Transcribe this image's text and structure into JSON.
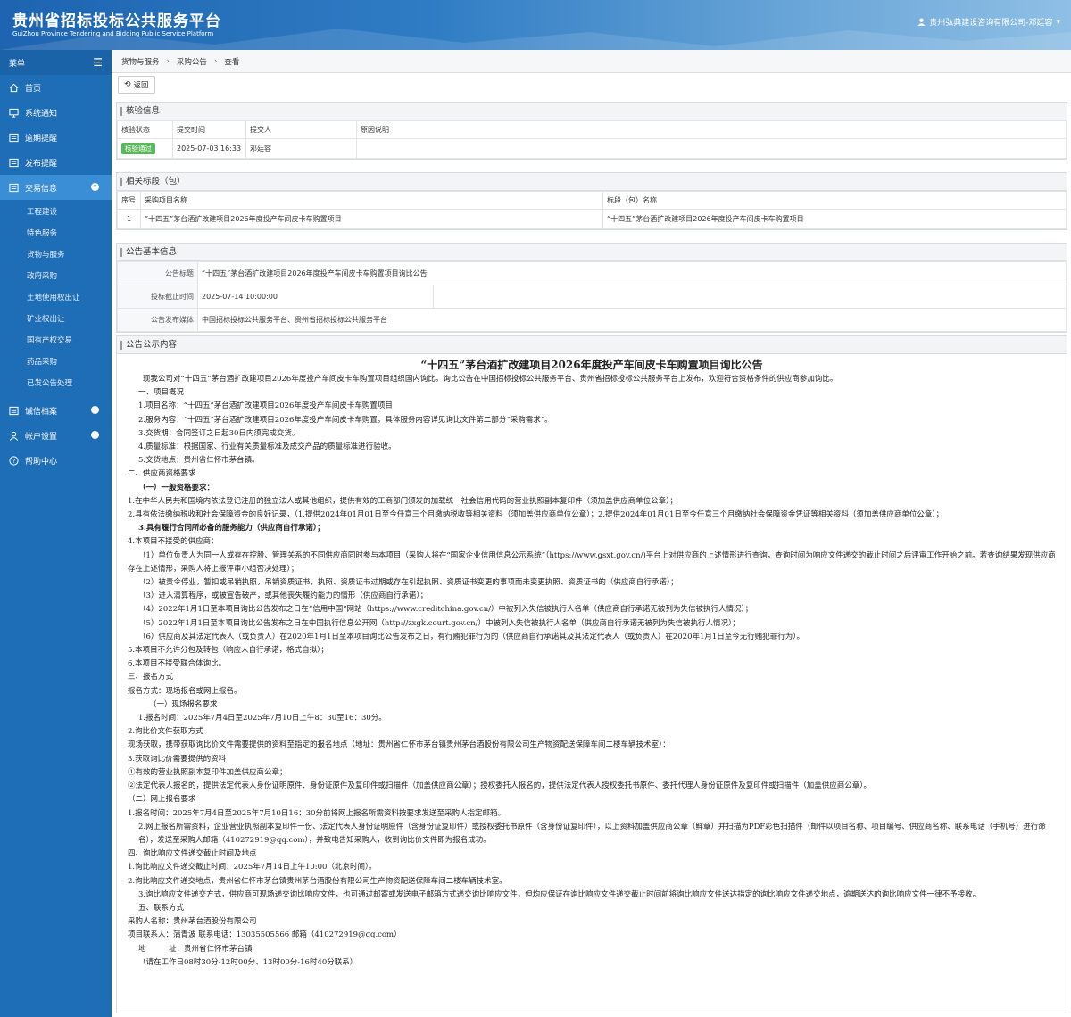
{
  "header": {
    "title": "贵州省招标投标公共服务平台",
    "subtitle": "GuiZhou Province Tendering and Bidding Public Service Platform",
    "user": "贵州弘典建设咨询有限公司-邓廷容"
  },
  "sidebar": {
    "menu_label": "菜单",
    "items": [
      {
        "label": "首页"
      },
      {
        "label": "系统通知"
      },
      {
        "label": "逾期提醒"
      },
      {
        "label": "发布提醒"
      },
      {
        "label": "交易信息"
      }
    ],
    "sub_items": [
      "工程建设",
      "特色服务",
      "货物与服务",
      "政府采购",
      "土地使用权出让",
      "矿业权出让",
      "国有产权交易",
      "药品采购",
      "已发公告处理"
    ],
    "bottom_items": [
      {
        "label": "诚信档案"
      },
      {
        "label": "帐户设置"
      },
      {
        "label": "帮助中心"
      }
    ]
  },
  "breadcrumb": [
    "货物与服务",
    "采购公告",
    "查看"
  ],
  "back_label": "返回",
  "verify": {
    "title": "核验信息",
    "headers": [
      "核验状态",
      "提交时间",
      "提交人",
      "原因说明"
    ],
    "row": {
      "status": "核验通过",
      "time": "2025-07-03 16:33",
      "person": "邓廷容",
      "reason": ""
    }
  },
  "sections": {
    "title": "相关标段（包）",
    "headers": [
      "序号",
      "采购项目名称",
      "标段（包）名称"
    ],
    "row": {
      "no": "1",
      "project": "“十四五”茅台酒扩改建项目2026年度投产车间皮卡车购置项目",
      "section": "“十四五”茅台酒扩改建项目2026年度投产车间皮卡车购置项目"
    }
  },
  "basic": {
    "title": "公告基本信息",
    "rows": [
      {
        "k": "公告标题",
        "v": "“十四五”茅台酒扩改建项目2026年度投产车间皮卡车购置项目询比公告"
      },
      {
        "k": "投标截止时间",
        "v": "2025-07-14 10:00:00"
      },
      {
        "k": "公告发布媒体",
        "v": "中国招标投标公共服务平台、贵州省招标投标公共服务平台"
      }
    ]
  },
  "notice": {
    "title": "公告公示内容",
    "heading": "“十四五”茅台酒扩改建项目2026年度投产车间皮卡车购置项目询比公告",
    "paragraphs": [
      "现我公司对“十四五”茅台酒扩改建项目2026年度投产车间皮卡车购置项目组织国内询比。询比公告在中国招标投标公共服务平台、贵州省招标投标公共服务平台上发布，欢迎符合资格条件的供应商参加询比。",
      "一、项目概况",
      "1.项目名称：“十四五”茅台酒扩改建项目2026年度投产车间皮卡车购置项目",
      "2.服务内容：“十四五”茅台酒扩改建项目2026年度投产车间皮卡车购置。具体服务内容详见询比文件第二部分“采购需求”。",
      "3.交货期：合同签订之日起30日内须完成交货。",
      "4.质量标准：根据国家、行业有关质量标准及成交产品的质量标准进行验收。",
      "5.交货地点：贵州省仁怀市茅台镇。",
      "二、供应商资格要求",
      "（一）一般资格要求：",
      "1.在中华人民共和国境内依法登记注册的独立法人或其他组织，提供有效的工商部门颁发的加载统一社会信用代码的营业执照副本复印件（须加盖供应商单位公章）；",
      "2.具有依法缴纳税收和社会保障资金的良好记录，（1.提供2024年01月01日至今任意三个月缴纳税收等相关资料（须加盖供应商单位公章）；2.提供2024年01月01日至今任意三个月缴纳社会保障资金凭证等相关资料（须加盖供应商单位公章）；",
      "3.具有履行合同所必备的服务能力（供应商自行承诺）；",
      "4.本项目不接受的供应商：",
      "（1）单位负责人为同一人或存在控股、管理关系的不同供应商同时参与本项目（采购人将在“国家企业信用信息公示系统”（https://www.gsxt.gov.cn/)平台上对供应商的上述情形进行查询，查询时间为响应文件递交的截止时间之后评审工作开始之前。若查询结果发现供应商存在上述情形，采购人将上报评审小组否决处理）；",
      "（2）被责令停业，暂扣或吊销执照，吊销资质证书，执照、资质证书过期或存在引起执照、资质证书变更的事项而未变更执照、资质证书的（供应商自行承诺）；",
      "（3）进入清算程序，或被宣告破产，或其他丧失履约能力的情形（供应商自行承诺）；",
      "（4）2022年1月1日至本项目询比公告发布之日在“信用中国”网站（https://www.creditchina.gov.cn/）中被列入失信被执行人名单（供应商自行承诺无被列为失信被执行人情况）；",
      "（5）2022年1月1日至本项目询比公告发布之日在中国执行信息公开网（http://zxgk.court.gov.cn/）中被列入失信被执行人名单（供应商自行承诺无被列为失信被执行人情况）；",
      "（6）供应商及其法定代表人（或负责人）在2020年1月1日至本项目询比公告发布之日，有行贿犯罪行为的（供应商自行承诺其及其法定代表人（或负责人）在2020年1月1日至今无行贿犯罪行为）。",
      "5.本项目不允许分包及转包（响应人自行承诺，格式自拟）；",
      "6.本项目不接受联合体询比。",
      "三、报名方式",
      "报名方式：现场报名或网上报名。",
      "（一）现场报名要求",
      "1.报名时间：2025年7月4日至2025年7月10日上午8：30至16：30分。",
      "2.询比价文件获取方式",
      "现场获取，携带获取询比价文件需要提供的资料至指定的报名地点（地址：贵州省仁怀市茅台镇贵州茅台酒股份有限公司生产物资配送保障车间二楼车辆技术室）：",
      "3.获取询比价需要提供的资料",
      "①有效的营业执照副本复印件加盖供应商公章；",
      "②法定代表人报名的，提供法定代表人身份证明原件、身份证原件及复印件或扫描件（加盖供应商公章）；授权委托人报名的，提供法定代表人授权委托书原件、委托代理人身份证原件及复印件或扫描件（加盖供应商公章）。",
      "（二）网上报名要求",
      "1.报名时间：2025年7月4日至2025年7月10日16：30分前将网上报名所需资料按要求发送至采购人指定邮箱。",
      "2.网上报名所需资料，企业营业执照副本复印件一份、法定代表人身份证明原件（含身份证复印件）或授权委托书原件（含身份证复印件），以上资料加盖供应商公章（鲜章）并扫描为PDF彩色扫描件（邮件以项目名称、项目编号、供应商名称、联系电话（手机号）进行命名），发送至采购人邮箱（410272919@qq.com），并致电告知采购人，收到询比价文件即为报名成功。",
      "四、询比响应文件递交截止时间及地点",
      "1.询比响应文件递交截止时间：2025年7月14日上午10:00（北京时间）。",
      "2.询比响应文件递交地点，贵州省仁怀市茅台镇贵州茅台酒股份有限公司生产物资配送保障车间二楼车辆技术室。",
      "3.询比响应文件递交方式，供应商可现场递交询比响应文件，也可通过邮寄或发送电子邮箱方式递交询比响应文件，但均应保证在询比响应文件递交截止时间前将询比响应文件送达指定的询比响应文件递交地点，逾期送达的询比响应文件一律不予接收。",
      "五、联系方式",
      "采购人名称：贵州茅台酒股份有限公司",
      "项目联系人：蒲青波 联系电话：13035505566 邮箱（410272919@qq.com）",
      "地　　　址：贵州省仁怀市茅台镇",
      "（请在工作日08时30分-12时00分、13时00分-16时40分联系）"
    ]
  }
}
